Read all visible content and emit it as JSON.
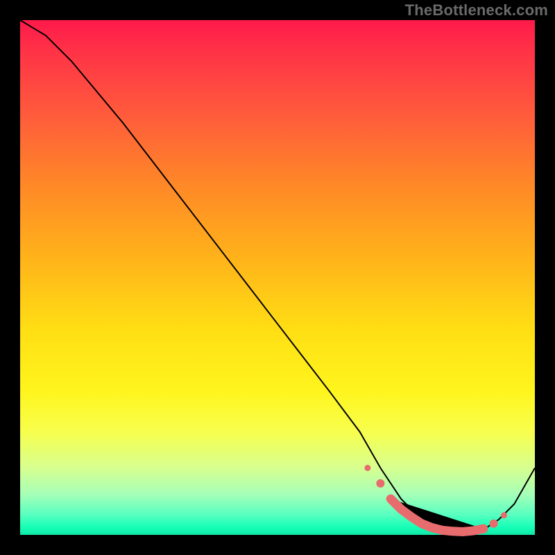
{
  "attribution": "TheBottleneck.com",
  "colors": {
    "page_bg": "#000000",
    "curve": "#000000",
    "marker": "#e86b6d",
    "gradient_top": "#ff1a4b",
    "gradient_bottom": "#11e7a8"
  },
  "chart_data": {
    "type": "line",
    "title": "",
    "xlabel": "",
    "ylabel": "",
    "xlim": [
      0,
      100
    ],
    "ylim": [
      0,
      100
    ],
    "series": [
      {
        "name": "bottleneck-curve",
        "x": [
          0,
          5,
          10,
          20,
          30,
          40,
          50,
          60,
          66,
          70,
          74,
          78,
          82,
          86,
          90,
          93,
          96,
          100
        ],
        "y": [
          100,
          97,
          92,
          80,
          67,
          54,
          41,
          28,
          20,
          13,
          7,
          3,
          1,
          0.5,
          1,
          3,
          6,
          13
        ]
      }
    ],
    "highlight_points": {
      "name": "optimal-range",
      "x": [
        67.5,
        70,
        72,
        74,
        76,
        78,
        80,
        82,
        84,
        86,
        88,
        90,
        92,
        94
      ],
      "y": [
        13,
        10,
        7,
        5,
        3.5,
        2.2,
        1.4,
        0.9,
        0.7,
        0.6,
        0.8,
        1.2,
        2.2,
        3.8
      ]
    }
  }
}
